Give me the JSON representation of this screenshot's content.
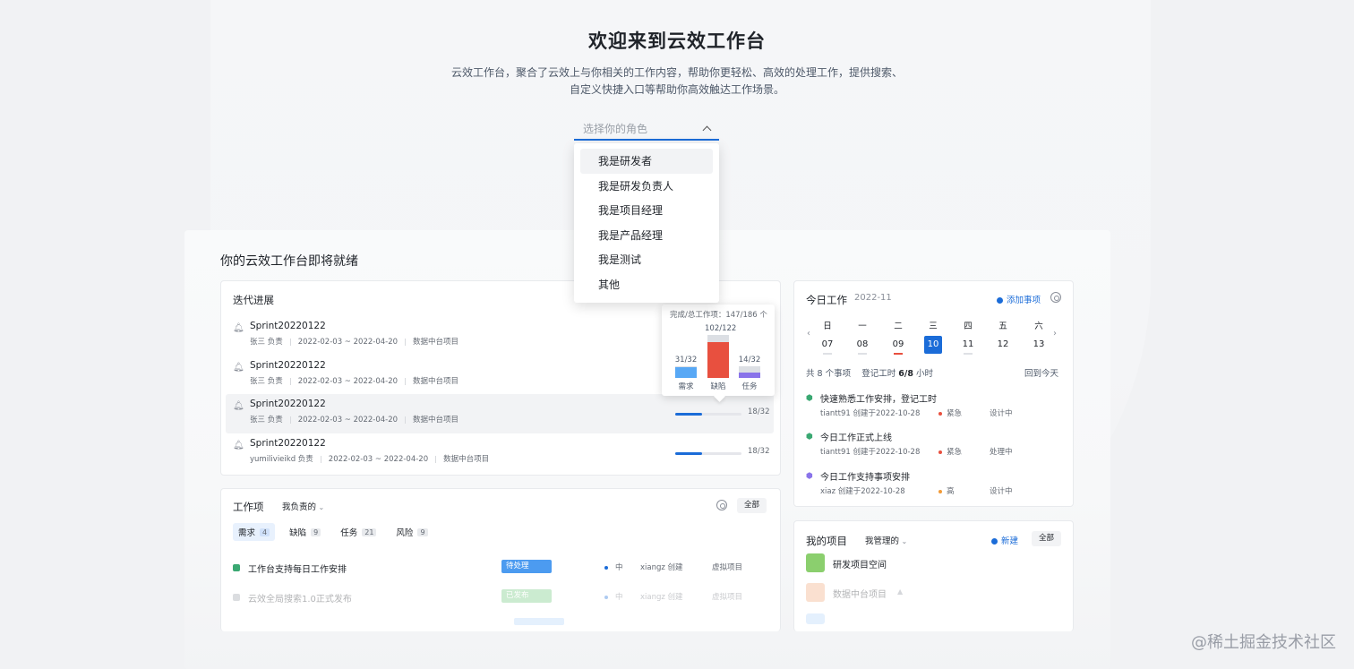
{
  "hero": {
    "title": "欢迎来到云效工作台",
    "desc1": "云效工作台，聚合了云效上与你相关的工作内容，帮助你更轻松、高效的处理工作，提供搜索、",
    "desc2": "自定义快捷入口等帮助你高效触达工作场景。"
  },
  "role_select": {
    "placeholder": "选择你的角色",
    "options": [
      "我是研发者",
      "我是研发负责人",
      "我是项目经理",
      "我是产品经理",
      "我是测试",
      "其他"
    ]
  },
  "board": {
    "title": "你的云效工作台即将就绪"
  },
  "iteration": {
    "title": "迭代进展",
    "rows": [
      {
        "name": "Sprint20220122",
        "owner": "张三 负责",
        "range": "2022-02-03 ~ 2022-04-20",
        "project": "数据中台项目",
        "progress": "",
        "ratio": 0
      },
      {
        "name": "Sprint20220122",
        "owner": "张三 负责",
        "range": "2022-02-03 ~ 2022-04-20",
        "project": "数据中台项目",
        "progress": "",
        "ratio": 0
      },
      {
        "name": "Sprint20220122",
        "owner": "张三 负责",
        "range": "2022-02-03 ~ 2022-04-20",
        "project": "数据中台项目",
        "progress": "18/32",
        "ratio": 0.4
      },
      {
        "name": "Sprint20220122",
        "owner": "yumilivieikd 负责",
        "range": "2022-02-03 ~ 2022-04-20",
        "project": "数据中台项目",
        "progress": "18/32",
        "ratio": 0.4
      }
    ],
    "tooltip": {
      "header": "完成/总工作项：147/186 个",
      "bars": [
        {
          "label": "需求",
          "value": "31/32",
          "done": 31,
          "total": 32,
          "color": "#58a8f5"
        },
        {
          "label": "缺陷",
          "value": "102/122",
          "done": 102,
          "total": 122,
          "color": "#e8503f"
        },
        {
          "label": "任务",
          "value": "14/32",
          "done": 14,
          "total": 32,
          "color": "#8a74ea"
        }
      ]
    }
  },
  "workitems": {
    "title": "工作项",
    "filter": "我负责的",
    "all_label": "全部",
    "tabs": [
      {
        "label": "需求",
        "count": "4"
      },
      {
        "label": "缺陷",
        "count": "9"
      },
      {
        "label": "任务",
        "count": "21"
      },
      {
        "label": "风险",
        "count": "9"
      }
    ],
    "rows": [
      {
        "title": "工作台支持每日工作安排",
        "status": "待处理",
        "status_color": "#4c9bf0",
        "priority": "中",
        "owner": "xiangz 创建",
        "project": "虚拟项目"
      },
      {
        "title": "云效全局搜索1.0正式发布",
        "status": "已发布",
        "status_color": "#6cc77a",
        "priority": "中",
        "owner": "xiangz 创建",
        "project": "虚拟项目"
      }
    ]
  },
  "today": {
    "title": "今日工作",
    "month": "2022-11",
    "add_label": "添加事项",
    "weekdays": [
      "日",
      "一",
      "二",
      "三",
      "四",
      "五",
      "六"
    ],
    "dates": [
      "07",
      "08",
      "09",
      "10",
      "11",
      "12",
      "13"
    ],
    "summary_count": "共 8 个事项",
    "summary_hours_label": "登记工时",
    "summary_hours": "6/8",
    "summary_unit": "小时",
    "back_today": "回到今天",
    "items": [
      {
        "title": "快速熟悉工作安排，登记工时",
        "meta": "tiantt91  创建于2022-10-28",
        "level": "紧急",
        "level_color": "#e8503f",
        "status": "设计中",
        "icon_color": "#3aa872"
      },
      {
        "title": "今日工作正式上线",
        "meta": "tiantt91  创建于2022-10-28",
        "level": "紧急",
        "level_color": "#e8503f",
        "status": "处理中",
        "icon_color": "#3aa872"
      },
      {
        "title": "今日工作支持事项安排",
        "meta": "xiaz  创建于2022-10-28",
        "level": "高",
        "level_color": "#f29b38",
        "status": "设计中",
        "icon_color": "#8a74ea"
      }
    ]
  },
  "projects": {
    "title": "我的项目",
    "filter": "我管理的",
    "new_label": "新建",
    "all_label": "全部",
    "items": [
      {
        "name": "研发项目空间",
        "color": "#8bcf6e"
      },
      {
        "name": "数据中台项目",
        "color": "#f2a77a"
      }
    ]
  },
  "watermark": "@稀土掘金技术社区"
}
